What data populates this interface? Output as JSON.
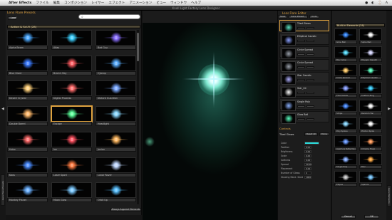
{
  "menubar": {
    "app_name": "After Effects",
    "items": [
      "ファイル",
      "編集",
      "コンポジション",
      "レイヤー",
      "エフェクト",
      "アニメーション",
      "ビュー",
      "ウィンドウ",
      "ヘルプ"
    ],
    "right": [
      "●",
      "◐",
      "⌚",
      "A"
    ]
  },
  "window": {
    "title": "Knoll Light Factory Lens Designer"
  },
  "presets": {
    "title": "Lens Flare Presets",
    "load_label": "Load",
    "search_placeholder": "",
    "reset_label": "Reset All",
    "clear_label": "⌫",
    "category": "Action & Sci-Fi (28)",
    "items": [
      {
        "label": "Alpha Beam",
        "color": "#4aa8ff"
      },
      {
        "label": "Atlas",
        "color": "#3ad0ff"
      },
      {
        "label": "Bad Guy",
        "color": "#8a6fff"
      },
      {
        "label": "Blue Giant",
        "color": "#3b7bff"
      },
      {
        "label": "Brain's Ray",
        "color": "#ff5a60"
      },
      {
        "label": "Cybrop",
        "color": "#5aaeff"
      },
      {
        "label": "Desert Crystal",
        "color": "#ffd07a"
      },
      {
        "label": "Digital Prowess",
        "color": "#ff6a6a"
      },
      {
        "label": "Distant Guardian",
        "color": "#7aa8ff"
      },
      {
        "label": "Double Barrel",
        "color": "#ffb86a"
      },
      {
        "label": "Escape",
        "color": "#5aff9a"
      },
      {
        "label": "Headlight",
        "color": "#8ad8ff"
      },
      {
        "label": "Hobo",
        "color": "#ff6a6a"
      },
      {
        "label": "Ion",
        "color": "#ff5060"
      },
      {
        "label": "Jovian",
        "color": "#ffb860"
      },
      {
        "label": "Kaos",
        "color": "#4a8cff"
      },
      {
        "label": "Laser Sport",
        "color": "#ff7a40"
      },
      {
        "label": "Lunar Rover",
        "color": "#c0d8ff"
      },
      {
        "label": "Monkey Planet",
        "color": "#6ab0ff"
      },
      {
        "label": "Moon Glow",
        "color": "#7ac8ff"
      },
      {
        "label": "Orbit Up",
        "color": "#58c0ff"
      }
    ],
    "always_append": "Always Append Elements"
  },
  "preview": {
    "header": ""
  },
  "editor": {
    "title": "Lens Flare Editor",
    "buttons": [
      "Save",
      "Save Preset...",
      "Undo"
    ],
    "elements": [
      {
        "name": "Tiled Glows",
        "color": "#5adfc0"
      },
      {
        "name": "Elliptical Caustic",
        "color": "#8aa0ff"
      },
      {
        "name": "Circle Spread",
        "color": "#9aa0aa"
      },
      {
        "name": "Circle Spread",
        "color": "#9aa0aa"
      },
      {
        "name": "Star Caustic",
        "color": "#b0b0ff"
      },
      {
        "name": "Star_20",
        "color": "#ffffff"
      },
      {
        "name": "Single Poly",
        "color": "#8ab0ff"
      },
      {
        "name": "Glow Ball",
        "color": "#5affc0"
      }
    ],
    "controls_title": "Controls",
    "controls_element": "Tiled Glows",
    "controls_buttons": [
      "Reset All",
      "Done"
    ],
    "params": [
      {
        "k": "Color",
        "v": ""
      },
      {
        "k": "Position",
        "v": "0.00"
      },
      {
        "k": "Brightness",
        "v": "0.00"
      },
      {
        "k": "Scale",
        "v": "0.00"
      },
      {
        "k": "Softness",
        "v": "0.00"
      },
      {
        "k": "Spread",
        "v": "20.00"
      },
      {
        "k": "Placement",
        "v": "0.00"
      },
      {
        "k": "Number of Glows",
        "v": "4"
      },
      {
        "k": "Glowing Rand. Seed",
        "v": "1000"
      }
    ]
  },
  "elements_panel": {
    "category": "Built-in Elements (28)",
    "items": [
      {
        "label": "Glow Ball",
        "color": "#3a8cff"
      },
      {
        "label": "Spike Ball",
        "color": "#ffffff"
      },
      {
        "label": "Disc Glow",
        "color": "#5adfff"
      },
      {
        "label": "Polygon Caustic",
        "color": "#d8d8ff"
      },
      {
        "label": "Circle Spread",
        "color": "#ffcc6a"
      },
      {
        "label": "Elliptical Caustic",
        "color": "#5affc0"
      },
      {
        "label": "Tiled Glows",
        "color": "#8aa0ff"
      },
      {
        "label": "Custom Ring",
        "color": "#3ad0ff"
      },
      {
        "label": "Stripe",
        "color": "#4a8cff"
      },
      {
        "label": "Random Fan",
        "color": "#ffffff"
      },
      {
        "label": "Poly Spikes",
        "color": "#8ad8ff"
      },
      {
        "label": "Photon Spike",
        "color": "#ffffff"
      },
      {
        "label": "Aperture Reflection",
        "color": "#6a9aff"
      },
      {
        "label": "Chroma Hoop",
        "color": "#ff9a5a"
      },
      {
        "label": "Single Poly",
        "color": "#8ab0ff"
      },
      {
        "label": "Disc",
        "color": "#ffaa44"
      },
      {
        "label": "Ellipse",
        "color": "#c8c8c8"
      },
      {
        "label": "Sparkle",
        "color": "#7ac8ff"
      }
    ]
  },
  "footer": {
    "cancel": "Cancel",
    "ok": "OK"
  },
  "side_tabs": {
    "left": "Lens Flare Presets",
    "right": "Lens Elements"
  }
}
